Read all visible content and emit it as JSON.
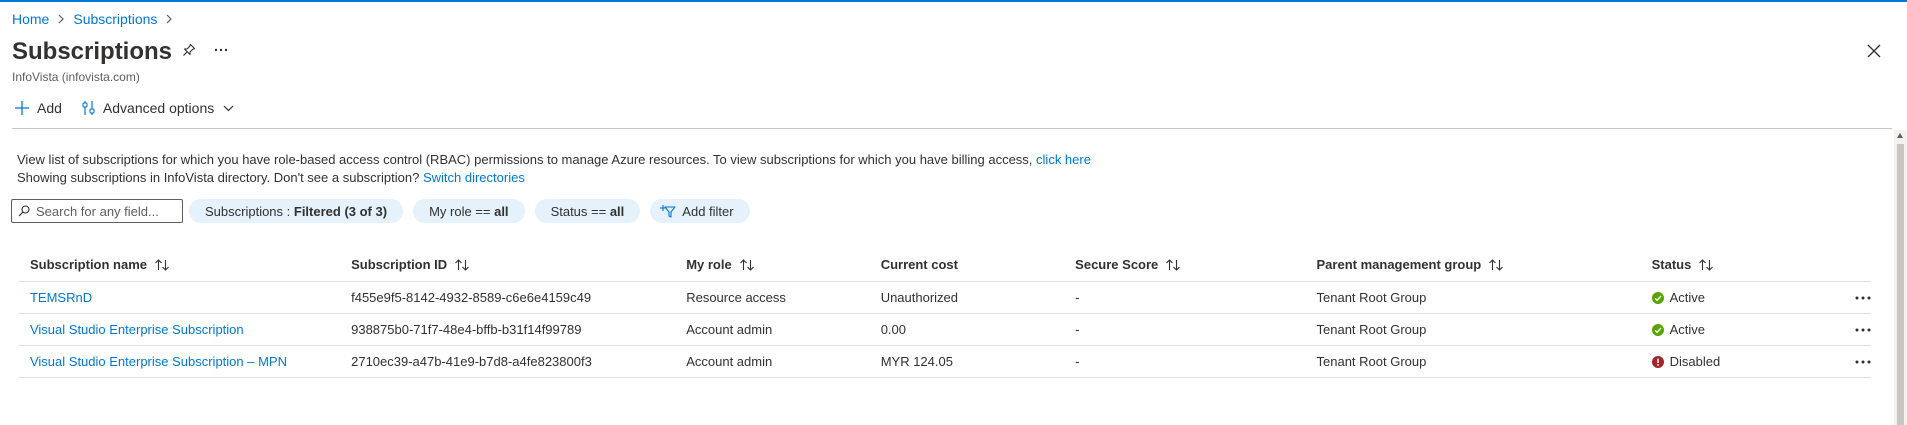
{
  "breadcrumb": {
    "home": "Home",
    "subscriptions": "Subscriptions"
  },
  "header": {
    "title": "Subscriptions",
    "subtitle": "InfoVista (infovista.com)"
  },
  "toolbar": {
    "add_label": "Add",
    "advanced_label": "Advanced options"
  },
  "info": {
    "line1_text": "View list of subscriptions for which you have role-based access control (RBAC) permissions to manage Azure resources. To view subscriptions for which you have billing access,",
    "line1_link": "click here",
    "line2_text": "Showing subscriptions in InfoVista directory. Don't see a subscription?",
    "line2_link": "Switch directories"
  },
  "filters": {
    "search_placeholder": "Search for any field...",
    "subscriptions_key": "Subscriptions : ",
    "subscriptions_value": "Filtered (3 of 3)",
    "role_key": "My role == ",
    "role_value": "all",
    "status_key": "Status == ",
    "status_value": "all",
    "add_filter_label": "Add filter"
  },
  "table": {
    "columns": {
      "name": "Subscription name",
      "id": "Subscription ID",
      "role": "My role",
      "cost": "Current cost",
      "score": "Secure Score",
      "pmg": "Parent management group",
      "status": "Status"
    },
    "rows": [
      {
        "name": "TEMSRnD",
        "id": "f455e9f5-8142-4932-8589-c6e6e4159c49",
        "role": "Resource access",
        "cost": "Unauthorized",
        "score": "-",
        "pmg": "Tenant Root Group",
        "status": "Active",
        "status_kind": "active"
      },
      {
        "name": "Visual Studio Enterprise Subscription",
        "id": "938875b0-71f7-48e4-bffb-b31f14f99789",
        "role": "Account admin",
        "cost": "0.00",
        "score": "-",
        "pmg": "Tenant Root Group",
        "status": "Active",
        "status_kind": "active"
      },
      {
        "name": "Visual Studio Enterprise Subscription – MPN",
        "id": "2710ec39-a47b-41e9-b7d8-a4fe823800f3",
        "role": "Account admin",
        "cost": "MYR 124.05",
        "score": "-",
        "pmg": "Tenant Root Group",
        "status": "Disabled",
        "status_kind": "disabled"
      }
    ]
  },
  "colors": {
    "accent": "#0078d4",
    "active": "#57a300",
    "disabled": "#a4262c",
    "pill_bg": "#e5f1fb"
  },
  "icons": {
    "pin": "pin-icon",
    "more": "ellipsis-icon",
    "close": "close-icon",
    "add": "plus-icon",
    "advanced": "advanced-options-icon",
    "chevron": "chevron-down-icon",
    "search": "search-icon",
    "filter": "add-filter-icon",
    "sort": "sort-icon",
    "active": "success-check-icon",
    "disabled": "error-icon"
  }
}
